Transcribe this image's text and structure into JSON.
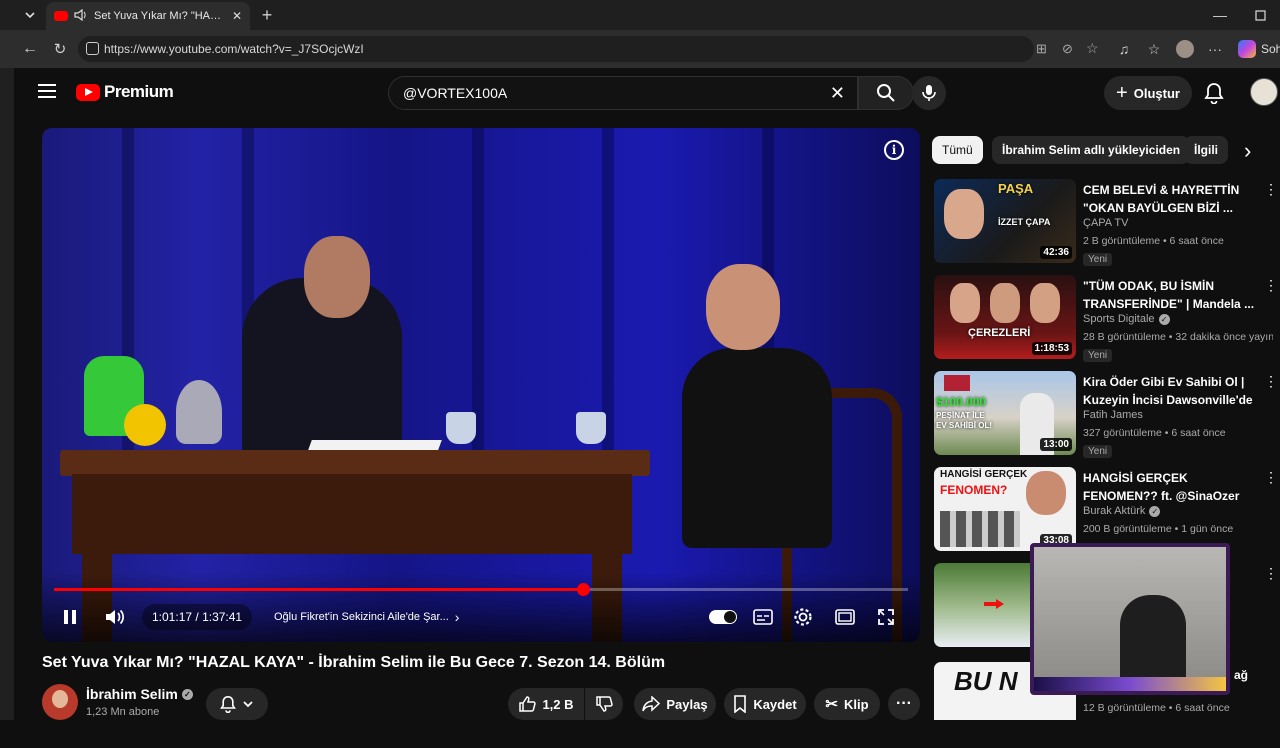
{
  "browser": {
    "tab_title": "Set Yuva Yıkar Mı? \"HAZAL KAYA\" - İbrahim Selim",
    "url": "https://www.youtube.com/watch?v=_J7SOcjcWzI",
    "copilot_label": "Soh"
  },
  "header": {
    "brand": "Premium",
    "search_value": "@VORTEX100A",
    "create_label": "Oluştur"
  },
  "player": {
    "time_current": "1:01:17",
    "time_total": "1:37:41",
    "progress": 0.62,
    "chapter": "Oğlu Fikret'in Sekizinci Aile'de Şar..."
  },
  "video": {
    "title": "Set Yuva Yıkar Mı? \"HAZAL KAYA\" - İbrahim Selim ile Bu Gece 7. Sezon 14. Bölüm",
    "channel": "İbrahim Selim",
    "subscribers": "1,23 Mn abone",
    "likes": "1,2 B",
    "share_label": "Paylaş",
    "save_label": "Kaydet",
    "clip_label": "Klip"
  },
  "chips": [
    "Tümü",
    "İbrahim Selim adlı yükleyiciden",
    "İlgili"
  ],
  "recommendations": [
    {
      "title": "CEM BELEVİ & HAYRETTİN \"OKAN BAYÜLGEN BİZİ ...",
      "channel": "ÇAPA TV",
      "meta": "2 B görüntüleme • 6 saat önce",
      "badge": "Yeni",
      "duration": "42:36",
      "verified": false
    },
    {
      "title": "\"TÜM ODAK, BU İSMİN TRANSFERİNDE\" | Mandela ...",
      "channel": "Sports Digitale",
      "meta": "28 B görüntüleme • 32 dakika önce yayın...",
      "badge": "Yeni",
      "duration": "1:18:53",
      "verified": true
    },
    {
      "title": "Kira Öder Gibi Ev Sahibi Ol | Kuzeyin İncisi Dawsonville'de ...",
      "channel": "Fatih James",
      "meta": "327 görüntüleme • 6 saat önce",
      "badge": "Yeni",
      "duration": "13:00",
      "verified": false
    },
    {
      "title": "HANGİSİ GERÇEK FENOMEN?? ft. @SinaOzer",
      "channel": "Burak Aktürk",
      "meta": "200 B görüntüleme • 1 gün önce",
      "badge": "",
      "duration": "33:08",
      "verified": true
    },
    {
      "title": "",
      "channel": "",
      "meta": "",
      "badge": "",
      "duration": "",
      "verified": false
    },
    {
      "title": "ağ",
      "channel": "",
      "meta": "12 B görüntüleme • 6 saat önce",
      "badge": "",
      "duration": "",
      "verified": false
    }
  ],
  "thumb_captions": {
    "t1_line1": "PAŞA",
    "t1_line2": "İZZET ÇAPA",
    "t2_line1": "ÇEREZLERİ",
    "t3_line1": "$100.000",
    "t3_line2": "PEŞİNAT İLE EV SAHİBİ OL!",
    "t4_line1": "HANGİSİ GERÇEK",
    "t4_line2": "FENOMEN?",
    "t6_line1": "BU N"
  },
  "colors": {
    "accent": "#ff0000",
    "background": "#0f0f0f",
    "surface": "#272727"
  }
}
